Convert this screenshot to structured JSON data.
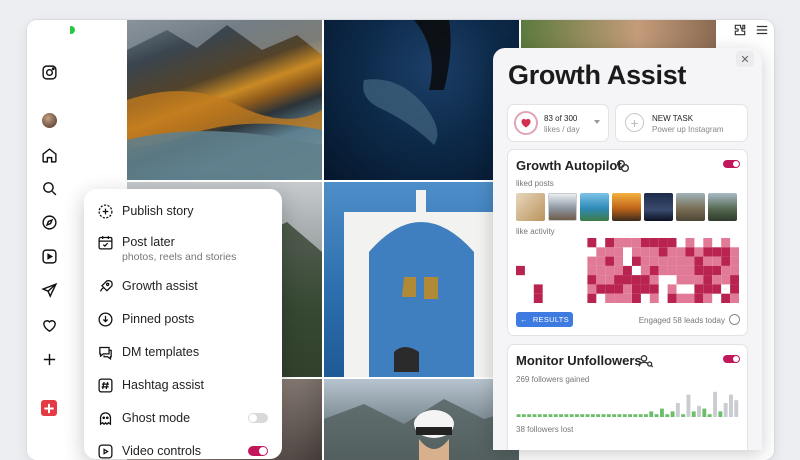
{
  "menu": {
    "items": [
      {
        "label": "Publish story",
        "icon": "story-plus-icon"
      },
      {
        "label": "Post later",
        "sub": "photos, reels and stories",
        "icon": "calendar-check-icon"
      },
      {
        "label": "Growth assist",
        "icon": "rocket-icon"
      },
      {
        "label": "Pinned posts",
        "icon": "pin-icon"
      },
      {
        "label": "DM templates",
        "icon": "chat-icon"
      },
      {
        "label": "Hashtag assist",
        "icon": "hashtag-icon"
      },
      {
        "label": "Ghost mode",
        "icon": "ghost-icon",
        "toggle": "off"
      },
      {
        "label": "Video controls",
        "icon": "play-icon",
        "toggle": "on"
      }
    ]
  },
  "panel": {
    "title": "Growth Assist",
    "close_icon": "close-icon",
    "likes_stat": {
      "value": "83 of 300",
      "unit": "likes / day"
    },
    "new_task": {
      "label": "NEW TASK",
      "sub": "Power up Instagram"
    },
    "autopilot": {
      "title": "Growth Autopilot",
      "liked_posts_label": "liked posts",
      "like_activity_label": "like activity",
      "results_label": "RESULTS",
      "engaged_text": "Engaged 58 leads today",
      "toggle": "on"
    },
    "unfollowers": {
      "title": "Monitor Unfollowers",
      "gained_label": "269 followers gained",
      "lost_label": "38 followers lost",
      "toggle": "on"
    }
  },
  "colors": {
    "accent": "#c2185b",
    "button_blue": "#3d7be0",
    "heat_light": "#e07a96",
    "heat_dark": "#b8234f"
  }
}
